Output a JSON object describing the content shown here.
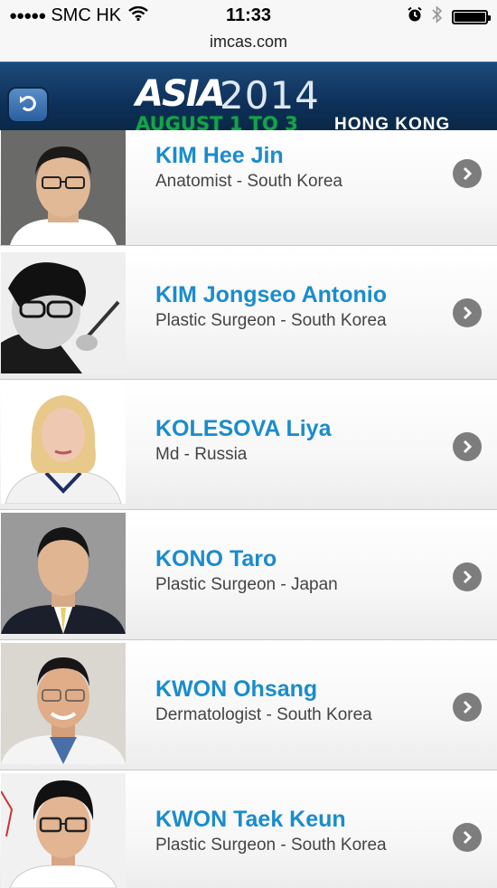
{
  "status_bar": {
    "carrier": "SMC HK",
    "time": "11:33",
    "signal_icon": "signal-dots-icon",
    "wifi_icon": "wifi-icon",
    "alarm_icon": "alarm-icon",
    "bluetooth_icon": "bluetooth-icon",
    "battery_icon": "battery-icon"
  },
  "url_bar": {
    "url": "imcas.com"
  },
  "header": {
    "back_icon": "back-arrow-icon",
    "logo_asia": "ASIA",
    "logo_year": "2014",
    "dates": "AUGUST 1 TO 3",
    "city": "HONG KONG",
    "colors": {
      "background": "#0d2f57",
      "dates": "#16a24a",
      "year": "#dfe8f2"
    }
  },
  "speakers": [
    {
      "name": "KIM Hee Jin",
      "title": "Anatomist - South Korea"
    },
    {
      "name": "KIM Jongseo Antonio",
      "title": "Plastic Surgeon - South Korea"
    },
    {
      "name": "KOLESOVA Liya",
      "title": "Md - Russia"
    },
    {
      "name": "KONO Taro",
      "title": "Plastic Surgeon - Japan"
    },
    {
      "name": "KWON Ohsang",
      "title": "Dermatologist - South Korea"
    },
    {
      "name": "KWON Taek Keun",
      "title": "Plastic Surgeon - South Korea"
    }
  ],
  "colors": {
    "name": "#1a8ccc",
    "title": "#444444",
    "chevron": "#7d7d7d"
  }
}
